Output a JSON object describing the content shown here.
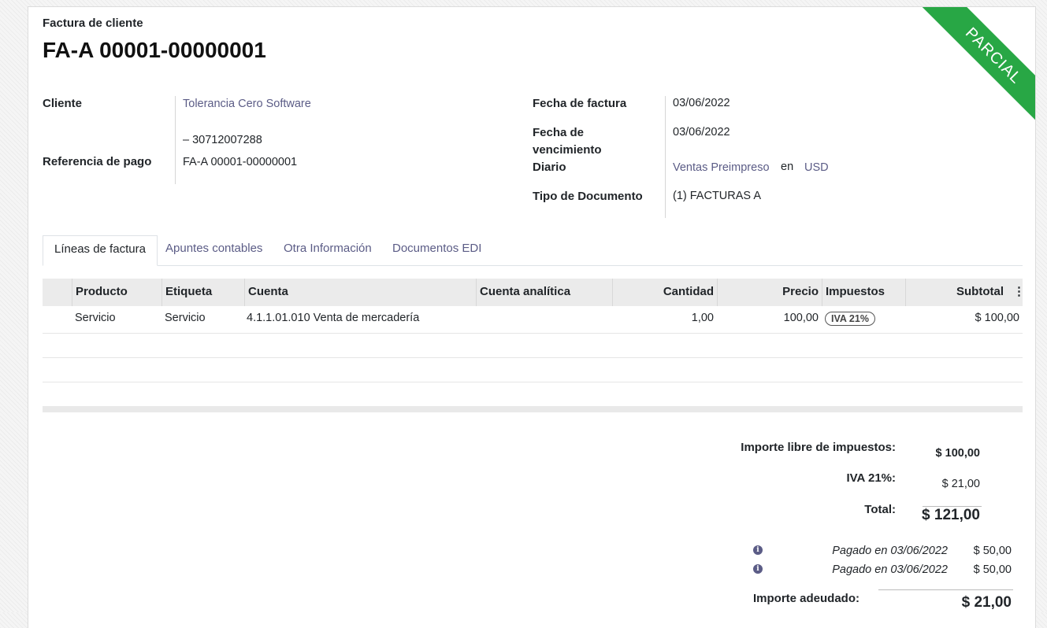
{
  "header": {
    "subtitle": "Factura de cliente",
    "title": "FA-A 00001-00000001",
    "ribbon": "PARCIAL",
    "ribbon_color": "#28a745"
  },
  "fields": {
    "cliente_label": "Cliente",
    "cliente_value": "Tolerancia Cero Software",
    "cliente_id": "– 30712007288",
    "referencia_label": "Referencia de pago",
    "referencia_value": "FA-A 00001-00000001",
    "fecha_factura_label": "Fecha de factura",
    "fecha_factura_value": "03/06/2022",
    "fecha_venc_label_1": "Fecha de",
    "fecha_venc_label_2": "vencimiento",
    "fecha_venc_value": "03/06/2022",
    "diario_label": "Diario",
    "diario_value": "Ventas Preimpreso",
    "diario_en": "en",
    "diario_moneda": "USD",
    "tipo_doc_label": "Tipo de Documento",
    "tipo_doc_value": "(1) FACTURAS A"
  },
  "tabs": [
    {
      "label": "Líneas de factura"
    },
    {
      "label": "Apuntes contables"
    },
    {
      "label": "Otra Información"
    },
    {
      "label": "Documentos EDI"
    }
  ],
  "table": {
    "headers": [
      "Producto",
      "Etiqueta",
      "Cuenta",
      "Cuenta analítica",
      "Cantidad",
      "Precio",
      "Impuestos",
      "Subtotal"
    ],
    "rows": [
      {
        "producto": "Servicio",
        "etiqueta": "Servicio",
        "cuenta": "4.1.1.01.010 Venta de mercadería",
        "analitica": "",
        "cantidad": "1,00",
        "precio": "100,00",
        "impuesto": "IVA 21%",
        "subtotal": "$ 100,00"
      }
    ]
  },
  "totals": {
    "libre_label": "Importe libre de impuestos:",
    "libre_value": "$ 100,00",
    "iva_label": "IVA 21%:",
    "iva_value": "$ 21,00",
    "total_label": "Total:",
    "total_value": "$ 121,00",
    "payments": [
      {
        "text": "Pagado en 03/06/2022",
        "amount": "$ 50,00"
      },
      {
        "text": "Pagado en 03/06/2022",
        "amount": "$ 50,00"
      }
    ],
    "adeudado_label": "Importe adeudado:",
    "adeudado_value": "$ 21,00"
  },
  "colors": {
    "link": "#5b5c86",
    "accent": "#28a745"
  }
}
